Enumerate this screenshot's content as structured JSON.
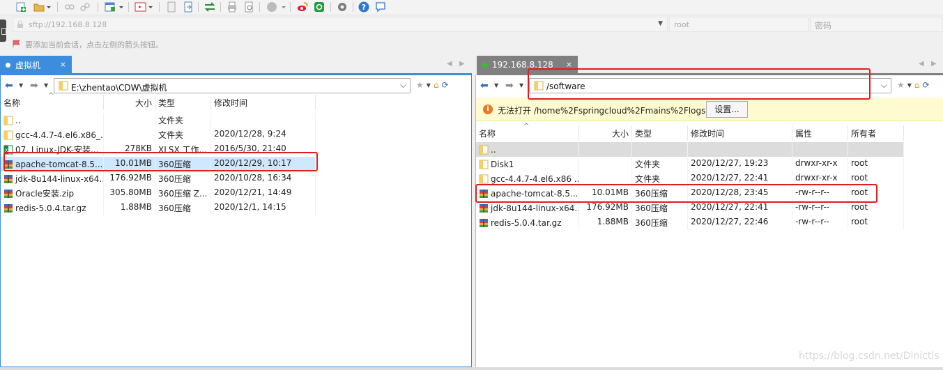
{
  "toolbar": {
    "icons": [
      "new-session-icon",
      "open-folder-icon",
      "disconnect-icon",
      "reconnect-icon",
      "new-window-icon",
      "terminal-icon",
      "copy-icon",
      "paste-icon",
      "sync-icon",
      "print-icon",
      "print-preview-icon",
      "record-icon",
      "weibo-icon",
      "360-icon",
      "settings-icon",
      "help-icon",
      "chat-icon"
    ]
  },
  "connection": {
    "host_placeholder": "sftp://192.168.8.128",
    "user_placeholder": "root",
    "password_placeholder": "密码",
    "hint": "要添加当前会话，点击左侧的箭头按钮。"
  },
  "left_pane": {
    "tab_label": "虚拟机",
    "tab_close": "×",
    "path": "E:\\zhentao\\CDW\\虚拟机",
    "columns": [
      "名称",
      "大小",
      "类型",
      "修改时间"
    ],
    "sort_indicator": "^",
    "files": [
      {
        "name": "..",
        "size": "",
        "type": "文件夹",
        "modified": "",
        "icon": "parent-folder-icon"
      },
      {
        "name": "gcc-4.4.7-4.el6.x86_...",
        "size": "",
        "type": "文件夹",
        "modified": "2020/12/28, 9:24",
        "icon": "folder-icon"
      },
      {
        "name": "07. Linux-JDK-安装...",
        "size": "278KB",
        "type": "XLSX 工作...",
        "modified": "2016/5/30, 21:40",
        "icon": "xlsx-icon"
      },
      {
        "name": "apache-tomcat-8.5....",
        "size": "10.01MB",
        "type": "360压缩",
        "modified": "2020/12/29, 10:17",
        "icon": "archive-icon"
      },
      {
        "name": "jdk-8u144-linux-x64...",
        "size": "176.92MB",
        "type": "360压缩",
        "modified": "2020/10/28, 16:34",
        "icon": "archive-icon"
      },
      {
        "name": "Oracle安装.zip",
        "size": "305.80MB",
        "type": "360压缩 Z...",
        "modified": "2020/12/21, 14:49",
        "icon": "archive-icon"
      },
      {
        "name": "redis-5.0.4.tar.gz",
        "size": "1.88MB",
        "type": "360压缩",
        "modified": "2020/12/1, 14:15",
        "icon": "archive-icon"
      }
    ]
  },
  "right_pane": {
    "tab_label": "192.168.8.128",
    "tab_close": "×",
    "path": "/software",
    "warning": "无法打开 /home%2Fspringcloud%2Fmains%2Flogs",
    "warning_button": "设置...",
    "columns": [
      "名称",
      "大小",
      "类型",
      "修改时间",
      "属性",
      "所有者"
    ],
    "sort_indicator": "^",
    "files": [
      {
        "name": "..",
        "size": "",
        "type": "",
        "modified": "",
        "attrs": "",
        "owner": "",
        "icon": "parent-folder-icon"
      },
      {
        "name": "Disk1",
        "size": "",
        "type": "文件夹",
        "modified": "2020/12/27, 19:23",
        "attrs": "drwxr-xr-x",
        "owner": "root",
        "icon": "folder-icon"
      },
      {
        "name": "gcc-4.4.7-4.el6.x86 ...",
        "size": "",
        "type": "文件夹",
        "modified": "2020/12/27, 22:41",
        "attrs": "drwxr-xr-x",
        "owner": "root",
        "icon": "folder-icon"
      },
      {
        "name": "apache-tomcat-8.5....",
        "size": "10.01MB",
        "type": "360压缩",
        "modified": "2020/12/28, 23:45",
        "attrs": "-rw-r--r--",
        "owner": "root",
        "icon": "archive-icon"
      },
      {
        "name": "jdk-8u144-linux-x64...",
        "size": "176.92MB",
        "type": "360压缩",
        "modified": "2020/12/27, 22:41",
        "attrs": "-rw-r--r--",
        "owner": "root",
        "icon": "archive-icon"
      },
      {
        "name": "redis-5.0.4.tar.gz",
        "size": "1.88MB",
        "type": "360压缩",
        "modified": "2020/12/27, 22:46",
        "attrs": "-rw-r--r--",
        "owner": "root",
        "icon": "archive-icon"
      }
    ]
  },
  "watermark": "https://blog.csdn.net/Dinictis",
  "colors": {
    "accent": "#3c8dde",
    "highlight": "#e21c1c",
    "selection": "#cde8ff"
  }
}
